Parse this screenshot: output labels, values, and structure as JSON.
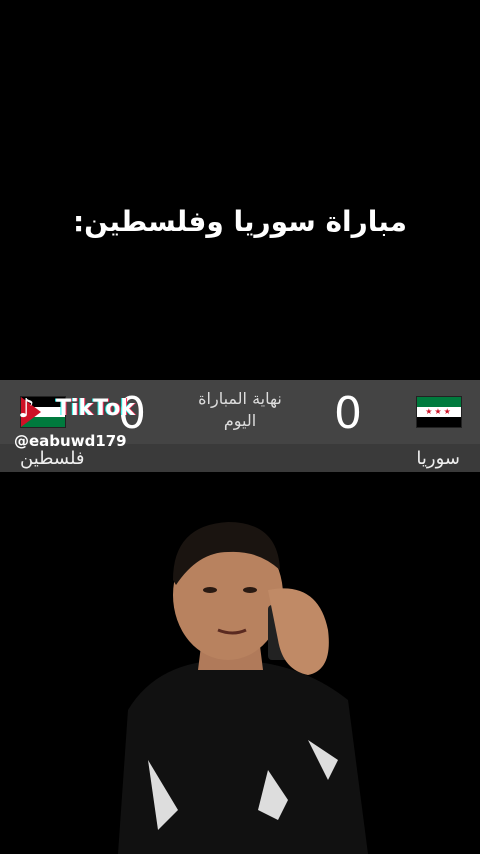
{
  "title": "مباراة سوريا وفلسطين:",
  "scoreboard": {
    "home_score": "0",
    "away_score": "0",
    "status_line1": "نهاية المباراة",
    "status_line2": "اليوم",
    "home_team": "سوريا",
    "away_team": "فلسطين",
    "colors": {
      "syria_green": "#007a3d",
      "red": "#ce1126",
      "bar": "#444444"
    }
  },
  "watermark": {
    "brand": "TikTok",
    "handle": "@eabuwd179",
    "icon": "tiktok-note-icon"
  }
}
